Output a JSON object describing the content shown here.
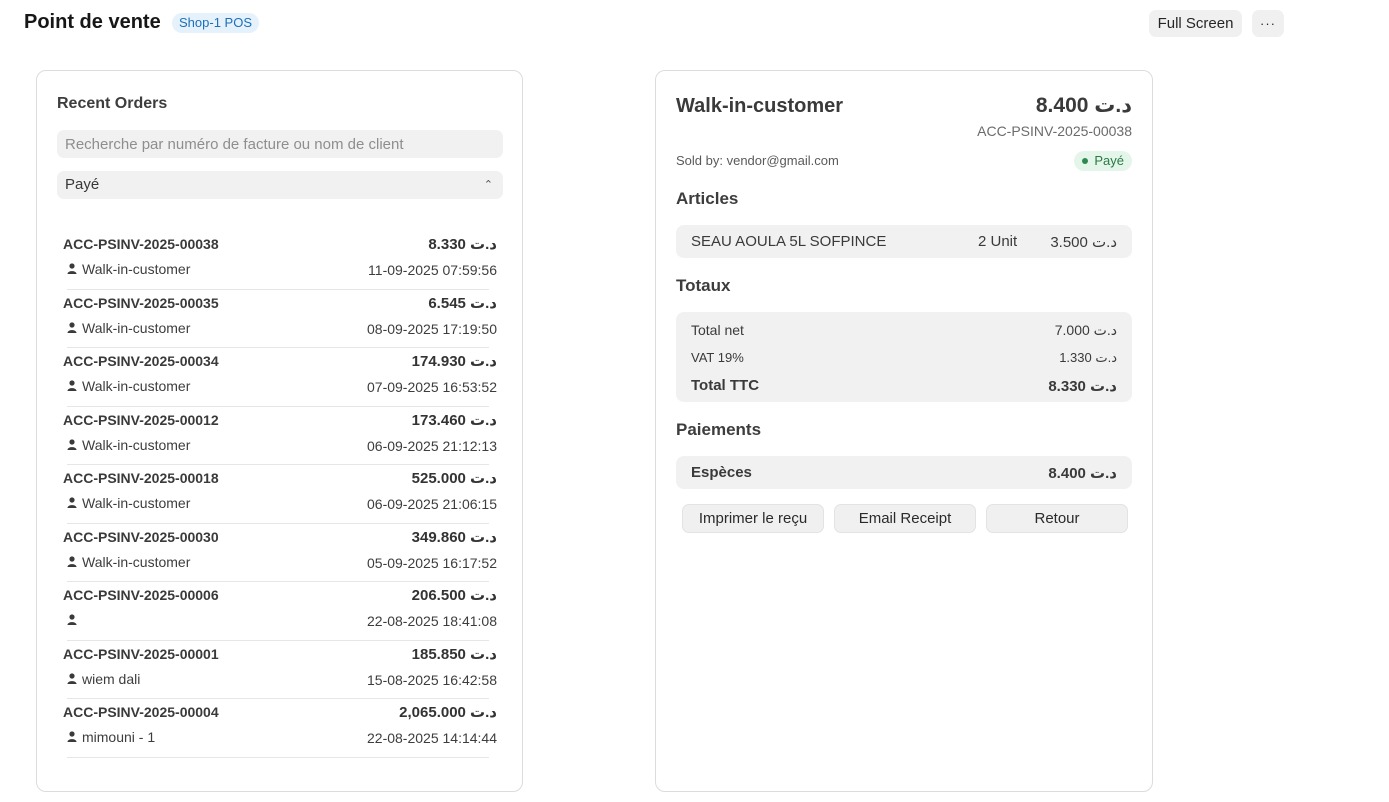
{
  "header": {
    "title": "Point de vente",
    "pos_badge": "Shop-1 POS",
    "fullscreen_label": "Full Screen",
    "more_label": "···"
  },
  "recent_orders": {
    "title": "Recent Orders",
    "search_placeholder": "Recherche par numéro de facture ou nom de client",
    "search_value": "",
    "status_filter": "Payé",
    "orders": [
      {
        "invoice": "ACC-PSINV-2025-00038",
        "amount": "د.ت 8.330",
        "customer": "Walk-in-customer",
        "date": "11-09-2025 07:59:56"
      },
      {
        "invoice": "ACC-PSINV-2025-00035",
        "amount": "د.ت 6.545",
        "customer": "Walk-in-customer",
        "date": "08-09-2025 17:19:50"
      },
      {
        "invoice": "ACC-PSINV-2025-00034",
        "amount": "د.ت 174.930",
        "customer": "Walk-in-customer",
        "date": "07-09-2025 16:53:52"
      },
      {
        "invoice": "ACC-PSINV-2025-00012",
        "amount": "د.ت 173.460",
        "customer": "Walk-in-customer",
        "date": "06-09-2025 21:12:13"
      },
      {
        "invoice": "ACC-PSINV-2025-00018",
        "amount": "د.ت 525.000",
        "customer": "Walk-in-customer",
        "date": "06-09-2025 21:06:15"
      },
      {
        "invoice": "ACC-PSINV-2025-00030",
        "amount": "د.ت 349.860",
        "customer": "Walk-in-customer",
        "date": "05-09-2025 16:17:52"
      },
      {
        "invoice": "ACC-PSINV-2025-00006",
        "amount": "د.ت 206.500",
        "customer": "",
        "date": "22-08-2025 18:41:08"
      },
      {
        "invoice": "ACC-PSINV-2025-00001",
        "amount": "د.ت 185.850",
        "customer": "wiem dali",
        "date": "15-08-2025 16:42:58"
      },
      {
        "invoice": "ACC-PSINV-2025-00004",
        "amount": "د.ت 2,065.000",
        "customer": "mimouni - 1",
        "date": "22-08-2025 14:14:44"
      }
    ]
  },
  "order_detail": {
    "customer": "Walk-in-customer",
    "grand_total": "د.ت 8.400",
    "invoice": "ACC-PSINV-2025-00038",
    "sold_by": "Sold by: vendor@gmail.com",
    "status": "Payé",
    "articles_title": "Articles",
    "items": [
      {
        "name": "SEAU AOULA 5L SOFPINCE",
        "qty": "2 Unit",
        "price": "د.ت 3.500"
      }
    ],
    "totals_title": "Totaux",
    "totals": {
      "net_label": "Total net",
      "net_value": "د.ت 7.000",
      "vat_label": "VAT 19%",
      "vat_value": "د.ت 1.330",
      "ttc_label": "Total TTC",
      "ttc_value": "د.ت 8.330"
    },
    "payments_title": "Paiements",
    "payment": {
      "method": "Espèces",
      "amount": "د.ت 8.400"
    },
    "buttons": {
      "print": "Imprimer le reçu",
      "email": "Email Receipt",
      "return": "Retour"
    }
  }
}
